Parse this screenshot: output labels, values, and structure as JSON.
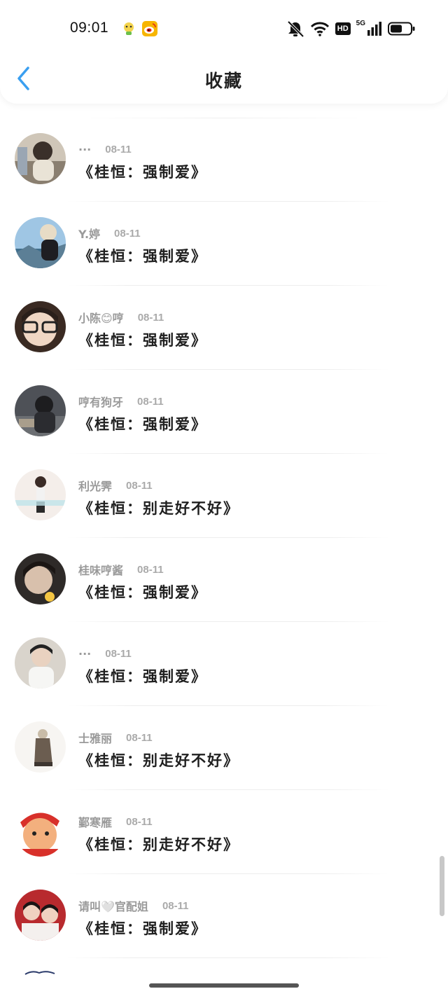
{
  "status_bar": {
    "time": "09:01",
    "notification_icons": [
      "app-mascot-icon",
      "weibo-icon"
    ],
    "system_icons": [
      "bell-muted-icon",
      "wifi-icon",
      "hd-icon",
      "signal-icon",
      "battery-icon"
    ],
    "hd_label": "HD",
    "network_label": "5G"
  },
  "header": {
    "title": "收藏",
    "back_icon": "chevron-left-icon"
  },
  "accent_color": "#3a9ff0",
  "items": [
    {
      "author": "···",
      "date": "08-11",
      "book": "《桂恒：强制爱》"
    },
    {
      "author": "Y.婷",
      "date": "08-11",
      "book": "《桂恒：强制爱》"
    },
    {
      "author": "小陈😊哼",
      "date": "08-11",
      "book": "《桂恒：强制爱》"
    },
    {
      "author": "哼有狗牙",
      "date": "08-11",
      "book": "《桂恒：强制爱》"
    },
    {
      "author": "利光霁",
      "date": "08-11",
      "book": "《桂恒：别走好不好》"
    },
    {
      "author": "桂味哼酱",
      "date": "08-11",
      "book": "《桂恒：强制爱》"
    },
    {
      "author": "···",
      "date": "08-11",
      "book": "《桂恒：强制爱》"
    },
    {
      "author": "士雅丽",
      "date": "08-11",
      "book": "《桂恒：别走好不好》"
    },
    {
      "author": "鄞寒雁",
      "date": "08-11",
      "book": "《桂恒：别走好不好》"
    },
    {
      "author": "请叫🤍官配姐",
      "date": "08-11",
      "book": "《桂恒：强制爱》"
    }
  ]
}
